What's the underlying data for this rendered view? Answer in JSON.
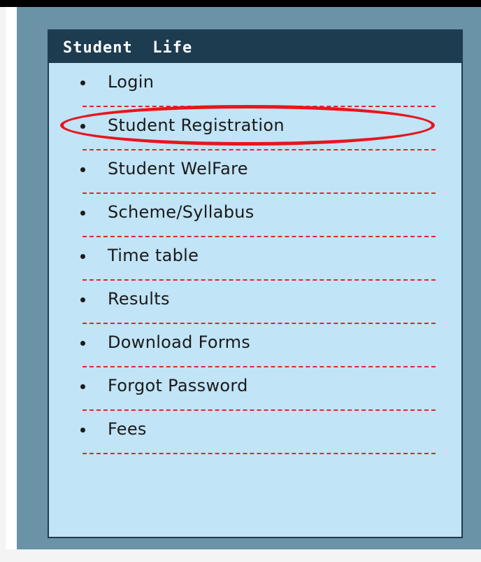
{
  "panel": {
    "title": "Student  Life"
  },
  "menu": {
    "items": [
      {
        "label": "Login"
      },
      {
        "label": "Student Registration"
      },
      {
        "label": "Student WelFare"
      },
      {
        "label": "Scheme/Syllabus"
      },
      {
        "label": "Time table"
      },
      {
        "label": "Results"
      },
      {
        "label": "Download Forms"
      },
      {
        "label": "Forgot Password"
      },
      {
        "label": "Fees"
      }
    ]
  },
  "colors": {
    "header_bg": "#1e3c50",
    "panel_bg": "#c1e4f6",
    "outer_bg": "#6b93a8",
    "separator": "#e0262c",
    "highlight": "#e8151d"
  }
}
